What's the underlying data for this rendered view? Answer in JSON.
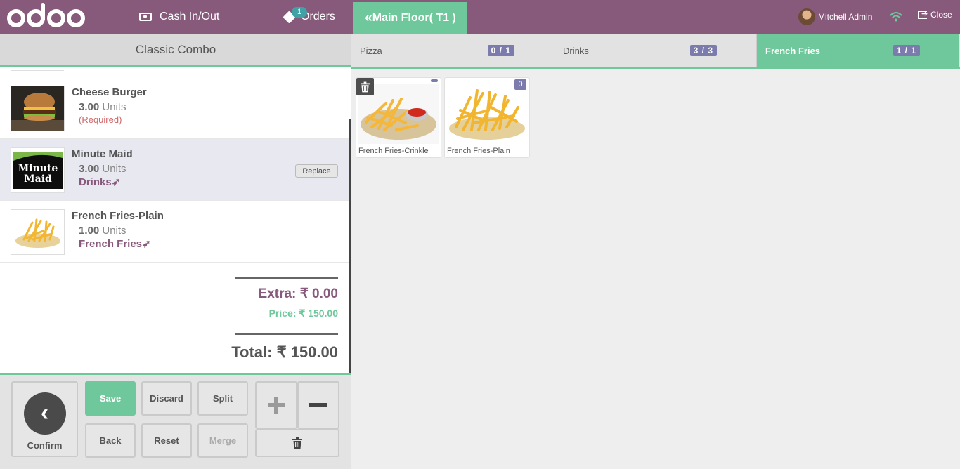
{
  "header": {
    "logo_text": "odoo",
    "cash_label": "Cash In/Out",
    "orders_label": "Orders",
    "orders_badge": "1",
    "floor_label": "Main Floor( T1 )",
    "user_name": "Mitchell Admin",
    "close_label": "Close"
  },
  "combo": {
    "title": "Classic Combo",
    "lines": [
      {
        "name": "Cheese Burger",
        "qty": "3.00",
        "unit": "Units",
        "note": "(Required)"
      },
      {
        "name": "Minute Maid",
        "qty": "3.00",
        "unit": "Units",
        "category": "Drinks",
        "replace_label": "Replace"
      },
      {
        "name": "French Fries-Plain",
        "qty": "1.00",
        "unit": "Units",
        "category": "French Fries"
      }
    ],
    "extra": "Extra: ₹ 0.00",
    "price": "Price: ₹ 150.00",
    "total": "Total: ₹ 150.00"
  },
  "controls": {
    "confirm": "Confirm",
    "save": "Save",
    "discard": "Discard",
    "split": "Split",
    "back": "Back",
    "reset": "Reset",
    "merge": "Merge"
  },
  "tabs": [
    {
      "label": "Pizza",
      "count": "0 / 1"
    },
    {
      "label": "Drinks",
      "count": "3 / 3"
    },
    {
      "label": "French Fries",
      "count": "1 / 1",
      "active": true
    }
  ],
  "products": [
    {
      "name": "French Fries-Crinkle"
    },
    {
      "name": "French Fries-Plain",
      "qty": "0"
    }
  ],
  "colors": {
    "header": "#875a7b",
    "accent_green": "#6ec89b",
    "badge_purple": "#7c7bad"
  }
}
